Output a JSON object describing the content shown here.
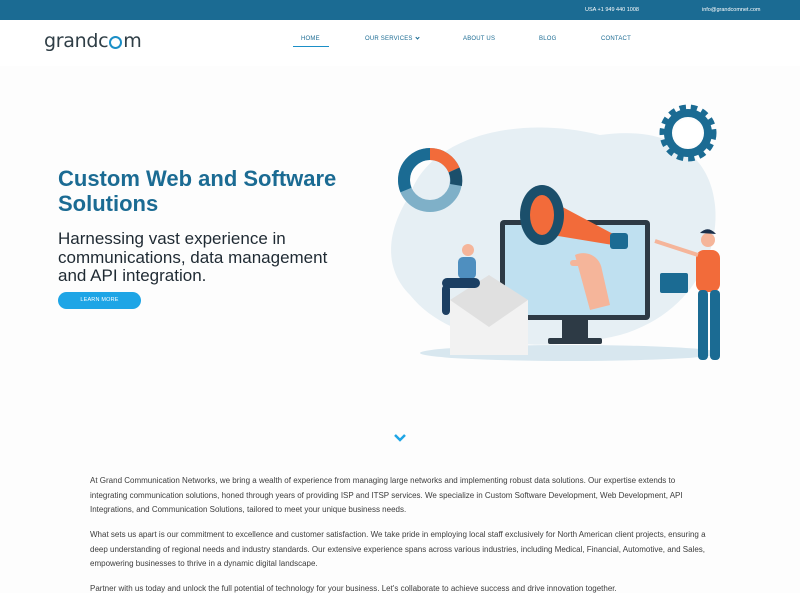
{
  "topbar": {
    "phone": "USA +1 949 440 1008",
    "email": "info@grandcomnet.com"
  },
  "logo": {
    "text_a": "grandc",
    "text_b": "m"
  },
  "nav": [
    {
      "label": "HOME"
    },
    {
      "label": "OUR SERVICES"
    },
    {
      "label": "ABOUT US"
    },
    {
      "label": "BLOG"
    },
    {
      "label": "CONTACT"
    }
  ],
  "hero": {
    "title": "Custom Web and Software Solutions",
    "subtitle": "Harnessing vast experience in communications, data management and API integration.",
    "cta": "LEARN MORE"
  },
  "content": {
    "p1": "At Grand Communication Networks, we bring a wealth of experience from managing large networks and implementing robust data solutions. Our expertise extends to integrating communication solutions, honed through years of providing ISP and ITSP services. We specialize in Custom Software Development, Web Development, API Integrations, and Communication Solutions, tailored to meet your unique business needs.",
    "p2": "What sets us apart is our commitment to excellence and customer satisfaction. We take pride in employing local staff exclusively for North American client projects, ensuring a deep understanding of regional needs and industry standards. Our extensive experience spans across various industries, including Medical, Financial, Automotive, and Sales, empowering businesses to thrive in a dynamic digital landscape.",
    "p3": "Partner with us today and unlock the full potential of technology for your business. Let's collaborate to achieve success and drive innovation together."
  },
  "colors": {
    "brand": "#1b6b93",
    "accent": "#1ea5e6",
    "orange": "#f26b3a"
  }
}
